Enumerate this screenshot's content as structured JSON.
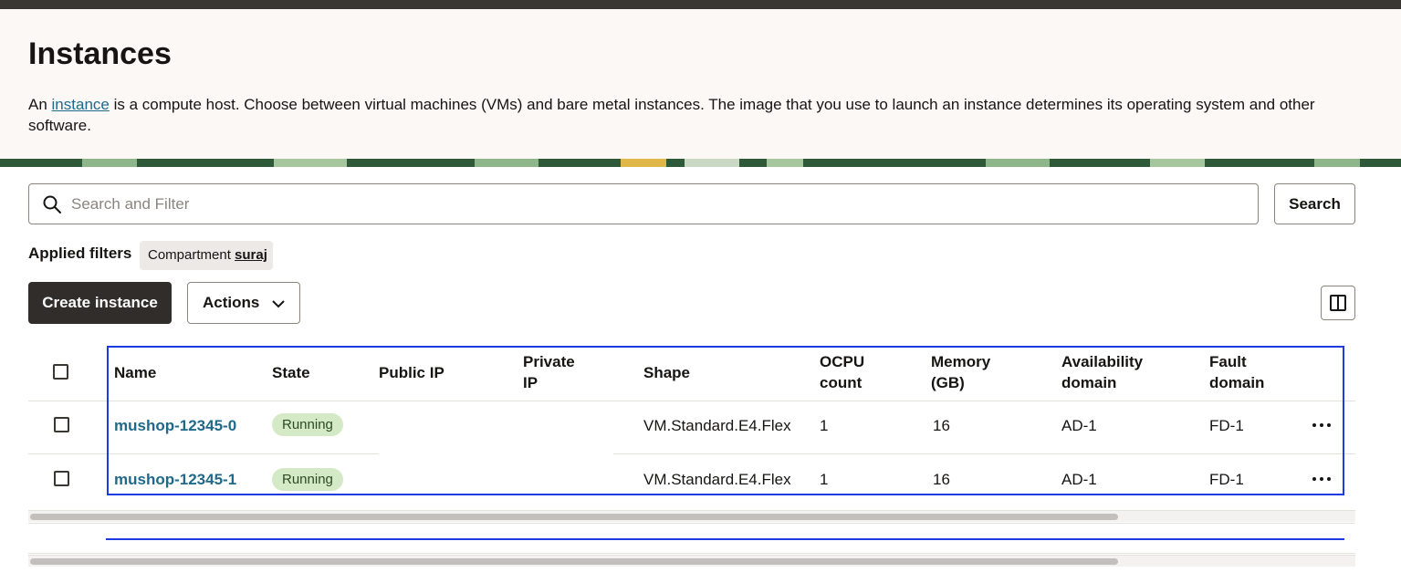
{
  "page": {
    "title": "Instances",
    "description_before_link": "An ",
    "description_link": "instance",
    "description_after_link": " is a compute host. Choose between virtual machines (VMs) and bare metal instances. The image that you use to launch an instance determines its operating system and other software."
  },
  "search": {
    "placeholder": "Search and Filter",
    "value": "",
    "button_label": "Search",
    "icon": "search-icon"
  },
  "filters": {
    "label": "Applied filters",
    "chip_key": "Compartment",
    "chip_value": "suraj"
  },
  "toolbar": {
    "create_label": "Create instance",
    "actions_label": "Actions",
    "actions_icon": "chevron-down-icon",
    "columns_icon": "column-settings-icon"
  },
  "table": {
    "headers": {
      "name": "Name",
      "state": "State",
      "public_ip": "Public IP",
      "private_ip_1": "Private",
      "private_ip_2": "IP",
      "shape": "Shape",
      "ocpu_1": "OCPU",
      "ocpu_2": "count",
      "memory_1": "Memory",
      "memory_2": "(GB)",
      "ad_1": "Availability",
      "ad_2": "domain",
      "fd_1": "Fault",
      "fd_2": "domain"
    },
    "rows": [
      {
        "name": "mushop-12345-0",
        "state": "Running",
        "public_ip": "",
        "private_ip": "",
        "shape": "VM.Standard.E4.Flex",
        "ocpu": "1",
        "memory": "16",
        "ad": "AD-1",
        "fd": "FD-1"
      },
      {
        "name": "mushop-12345-1",
        "state": "Running",
        "public_ip": "",
        "private_ip": "",
        "shape": "VM.Standard.E4.Flex",
        "ocpu": "1",
        "memory": "16",
        "ad": "AD-1",
        "fd": "FD-1"
      }
    ]
  },
  "colors": {
    "accent_link": "#1f6a8a",
    "selection_outline": "#1f3ae0",
    "running_badge_bg": "#d4eac7",
    "primary_button_bg": "#312d2a"
  }
}
